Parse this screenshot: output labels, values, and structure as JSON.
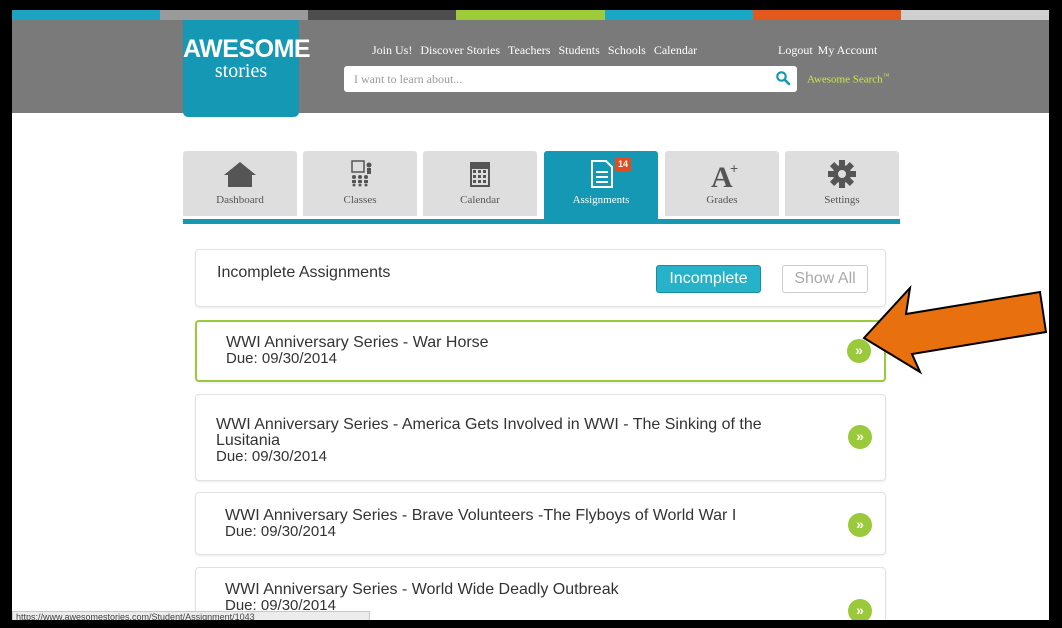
{
  "logo": {
    "line1": "AWESOME",
    "line2": "stories"
  },
  "top_nav": [
    "Join Us!",
    "Discover Stories",
    "Teachers",
    "Students",
    "Schools",
    "Calendar"
  ],
  "account_nav": [
    "Logout",
    "My Account"
  ],
  "search": {
    "placeholder": "I want to learn about...",
    "awesome_search_label": "Awesome Search",
    "trademark": "™"
  },
  "tabs": [
    {
      "label": "Dashboard",
      "icon": "home-icon"
    },
    {
      "label": "Classes",
      "icon": "classroom-icon"
    },
    {
      "label": "Calendar",
      "icon": "calendar-icon"
    },
    {
      "label": "Assignments",
      "icon": "document-icon",
      "badge": "14",
      "active": true
    },
    {
      "label": "Grades",
      "icon": "grade-a-plus-icon"
    },
    {
      "label": "Settings",
      "icon": "gear-icon"
    }
  ],
  "assignments_panel": {
    "title": "Incomplete Assignments",
    "filter_incomplete": "Incomplete",
    "filter_show_all": "Show All"
  },
  "assignments": [
    {
      "title": "WWI Anniversary Series - War Horse",
      "due": "Due: 09/30/2014",
      "highlighted": true
    },
    {
      "title_line1": "WWI Anniversary Series - America Gets Involved in WWI - The Sinking of the",
      "title_line2": "Lusitania",
      "due": "Due: 09/30/2014"
    },
    {
      "title": "WWI Anniversary Series - Brave Volunteers -The Flyboys of World War I",
      "due": "Due: 09/30/2014"
    },
    {
      "title": "WWI Anniversary Series - World Wide Deadly Outbreak",
      "due": "Due: 09/30/2014"
    }
  ],
  "go_button_glyph": "»",
  "status_bar_url": "https://www.awesomestories.com/Student/Assignment/1043",
  "colors": {
    "brand_teal": "#1498b3",
    "header_gray": "#7a7a7a",
    "accent_green": "#9ac93b",
    "badge_red": "#e64b1f",
    "annotation_orange": "#e8700f",
    "stripe": [
      "#1ba3c1",
      "#9a9a9a",
      "#4d4d4d",
      "#9ecb3a",
      "#19a7c6",
      "#e2591e",
      "#cfcfcf"
    ]
  }
}
